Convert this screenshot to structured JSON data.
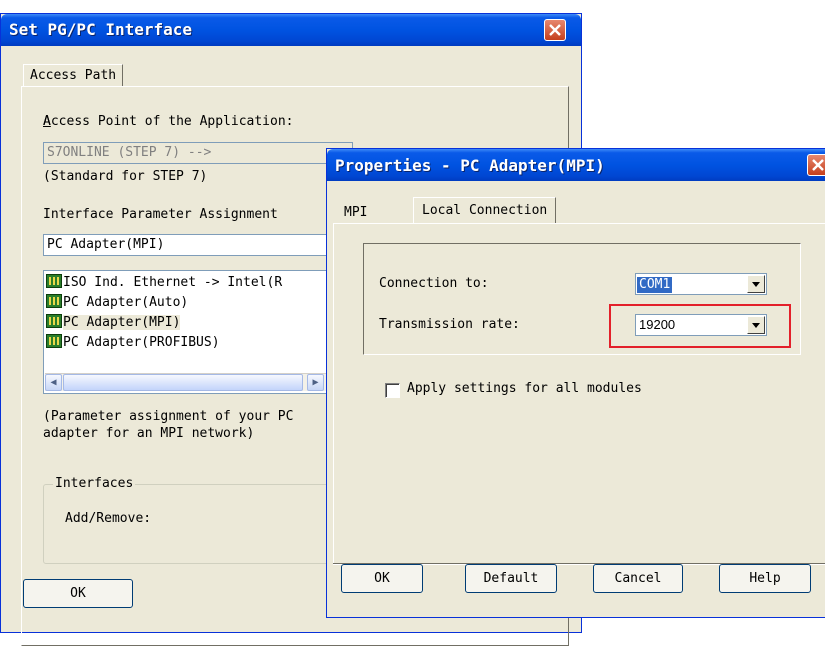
{
  "main_dialog": {
    "title": "Set PG/PC Interface",
    "tab_access_path": "Access Path",
    "access_point_label": "Access Point of the Application:",
    "access_point_value": "S7ONLINE      (STEP 7)      -->",
    "access_point_note": "(Standard for STEP 7)",
    "param_assignment_label": "Interface Parameter Assignment",
    "param_assignment_value": "PC Adapter(MPI)",
    "interfaces": [
      "ISO Ind. Ethernet -> Intel(R",
      "PC Adapter(Auto)",
      "PC Adapter(MPI)",
      "PC Adapter(PROFIBUS)"
    ],
    "selected_interface_index": 2,
    "description_line1": "(Parameter assignment of your PC",
    "description_line2": "adapter for an MPI network)",
    "interfaces_group_label": "Interfaces",
    "add_remove_label": "Add/Remove:",
    "ok_label": "OK"
  },
  "properties_dialog": {
    "title": "Properties - PC Adapter(MPI)",
    "tabs": [
      "MPI",
      "Local Connection"
    ],
    "active_tab": "Local Connection",
    "connection_to_label": "Connection to:",
    "connection_to_value": "COM1",
    "transmission_rate_label": "Transmission rate:",
    "transmission_rate_value": "19200",
    "apply_all_label": "Apply settings for all modules",
    "apply_all_checked": false,
    "buttons": {
      "ok": "OK",
      "default": "Default",
      "cancel": "Cancel",
      "help": "Help"
    },
    "highlight_color": "#e3202a"
  },
  "colors": {
    "titlebar": "#0053e1",
    "dialog_face": "#ece9d8",
    "selection": "#316ac5"
  }
}
